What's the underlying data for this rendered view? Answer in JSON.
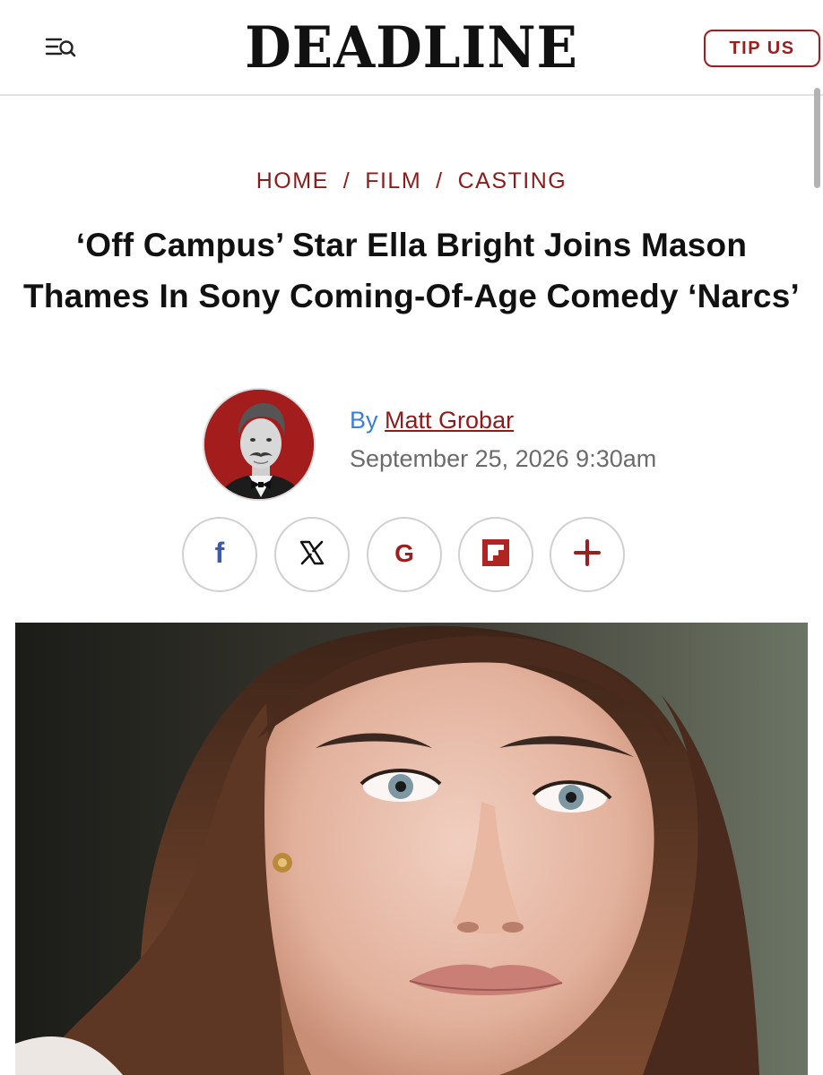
{
  "header": {
    "logo": "DEADLINE",
    "tip_label": "TIP US",
    "menu_icon": "menu-search-icon"
  },
  "breadcrumb": {
    "items": [
      "HOME",
      "FILM",
      "CASTING"
    ],
    "separator": "/"
  },
  "article": {
    "headline": "‘Off Campus’ Star Ella Bright Joins Mason Thames In Sony Coming-Of-Age Comedy ‘Narcs’",
    "by_label": "By",
    "author": "Matt Grobar",
    "date": "September 25, 2026 9:30am"
  },
  "share": {
    "icons": [
      "facebook-icon",
      "x-icon",
      "google-icon",
      "flipboard-icon",
      "plus-icon"
    ]
  },
  "colors": {
    "brand_red": "#9c1f1f",
    "byline_blue": "#3b7fd6",
    "facebook_blue": "#3b5ba9",
    "date_gray": "#6b6b6b"
  }
}
